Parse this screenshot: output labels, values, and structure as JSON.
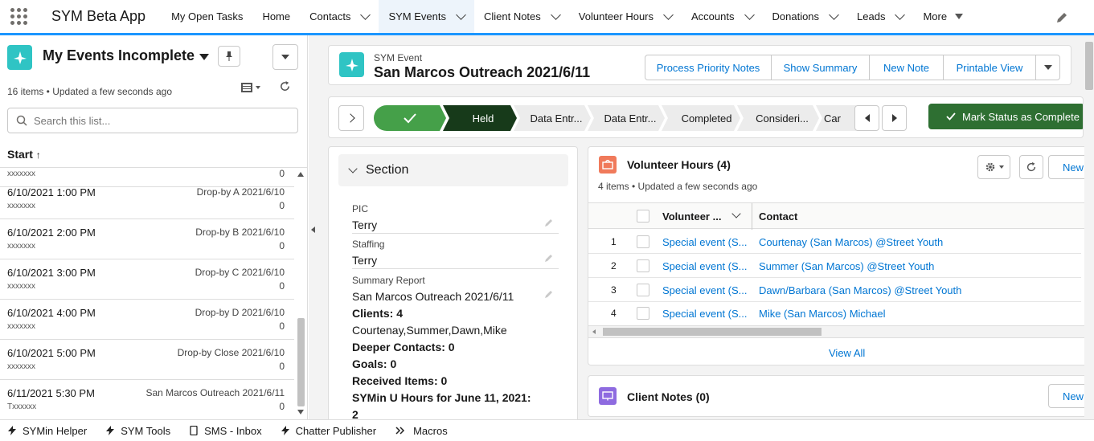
{
  "app": {
    "name": "SYM Beta App"
  },
  "nav": {
    "items": [
      {
        "label": "My Open Tasks"
      },
      {
        "label": "Home"
      },
      {
        "label": "Contacts"
      },
      {
        "label": "SYM Events"
      },
      {
        "label": "Client Notes"
      },
      {
        "label": "Volunteer Hours"
      },
      {
        "label": "Accounts"
      },
      {
        "label": "Donations"
      },
      {
        "label": "Leads"
      },
      {
        "label": "More"
      }
    ]
  },
  "list": {
    "title": "My Events Incomplete",
    "meta": "16 items • Updated a few seconds ago",
    "search_placeholder": "Search this list...",
    "column": "Start",
    "rows": [
      {
        "date": "6/10/2021 1:00 PM",
        "sub": "xxxxxxx",
        "name": "Drop-by A 2021/6/10",
        "num": "0"
      },
      {
        "date": "6/10/2021 2:00 PM",
        "sub": "xxxxxxx",
        "name": "Drop-by B 2021/6/10",
        "num": "0"
      },
      {
        "date": "6/10/2021 3:00 PM",
        "sub": "xxxxxxx",
        "name": "Drop-by C 2021/6/10",
        "num": "0"
      },
      {
        "date": "6/10/2021 4:00 PM",
        "sub": "xxxxxxx",
        "name": "Drop-by D 2021/6/10",
        "num": "0"
      },
      {
        "date": "6/10/2021 5:00 PM",
        "sub": "xxxxxxx",
        "name": "Drop-by Close 2021/6/10",
        "num": "0"
      },
      {
        "date": "6/11/2021 5:30 PM",
        "sub": "Txxxxxx",
        "name": "San Marcos Outreach 2021/6/11",
        "num": "0"
      }
    ],
    "partial_top": {
      "sub": "xxxxxxx",
      "num": "0"
    }
  },
  "record": {
    "object": "SYM Event",
    "title": "San Marcos Outreach 2021/6/11",
    "actions": [
      "Process Priority Notes",
      "Show Summary",
      "New Note",
      "Printable View"
    ]
  },
  "path": {
    "steps": [
      "Held",
      "Data Entr...",
      "Data Entr...",
      "Completed",
      "Consideri...",
      "Car"
    ],
    "mark_label": "Mark Status as Complete"
  },
  "section": {
    "title": "Section",
    "pic_label": "PIC",
    "pic_value": "Terry",
    "staffing_label": "Staffing",
    "staffing_value": "Terry",
    "summary_label": "Summary Report",
    "summary_lines": [
      "San Marcos Outreach 2021/6/11",
      "Clients: 4",
      "Courtenay,Summer,Dawn,Mike",
      "Deeper Contacts: 0",
      "Goals: 0",
      "Received Items: 0",
      "SYMin U Hours for June 11, 2021:",
      "2"
    ]
  },
  "vol_hours": {
    "title": "Volunteer Hours (4)",
    "meta": "4 items • Updated a few seconds ago",
    "new_label": "New",
    "col1": "Volunteer ...",
    "col2": "Contact",
    "rows": [
      {
        "n": "1",
        "vol": "Special event (S...",
        "contact": "Courtenay (San Marcos) @Street Youth"
      },
      {
        "n": "2",
        "vol": "Special event (S...",
        "contact": "Summer (San Marcos) @Street Youth"
      },
      {
        "n": "3",
        "vol": "Special event (S...",
        "contact": "Dawn/Barbara (San Marcos) @Street Youth"
      },
      {
        "n": "4",
        "vol": "Special event (S...",
        "contact": "Mike (San Marcos) Michael"
      }
    ],
    "view_all": "View All"
  },
  "client_notes": {
    "title": "Client Notes (0)",
    "new_label": "New"
  },
  "utility": [
    "SYMin Helper",
    "SYM Tools",
    "SMS - Inbox",
    "Chatter Publisher",
    "Macros"
  ],
  "colors": {
    "accent": "#0176d3",
    "brand_teal": "#2fc4c4",
    "path_green": "#45a049",
    "path_dark": "#173a1a",
    "mark_btn": "#2e6f32"
  }
}
